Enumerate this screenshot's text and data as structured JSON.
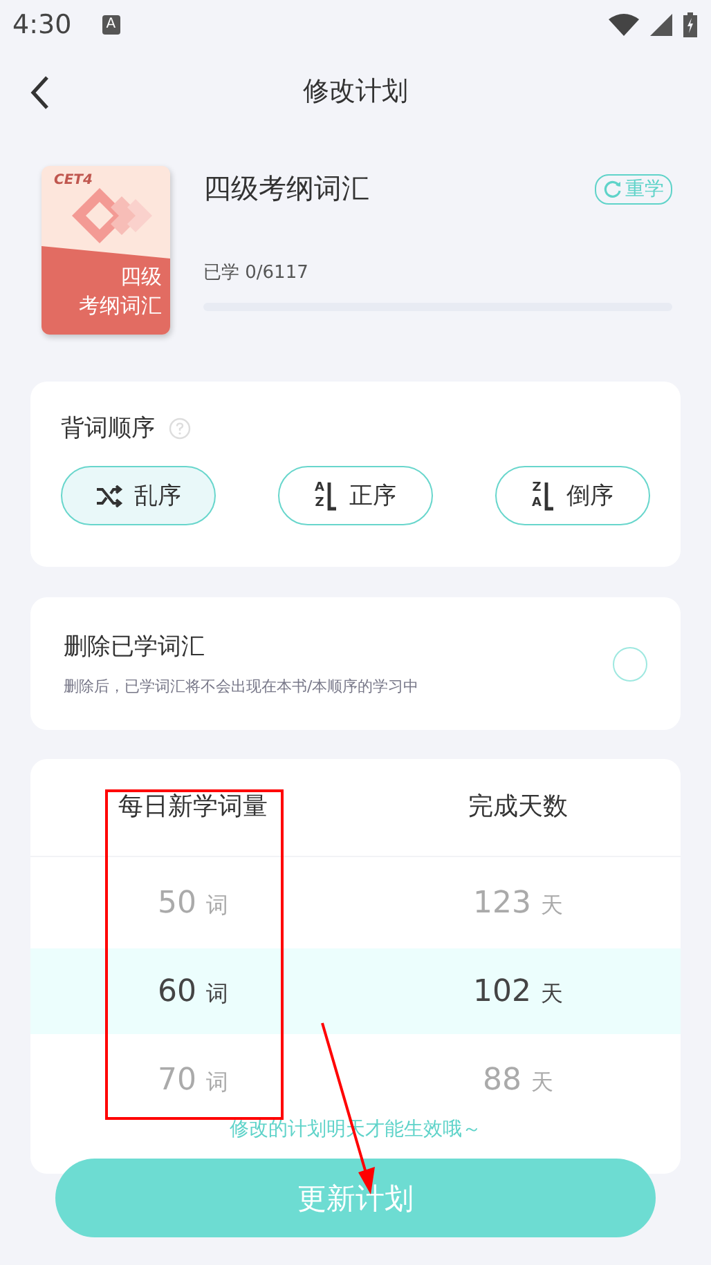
{
  "status_bar": {
    "time": "4:30",
    "notification_icon": "A"
  },
  "header": {
    "title": "修改计划"
  },
  "book": {
    "cover_tag": "CET4",
    "cover_title_line1": "四级",
    "cover_title_line2": "考纲词汇",
    "title": "四级考纲词汇",
    "restart": "重学",
    "progress_text": "已学 0/6117",
    "level": 0
  },
  "order": {
    "title": "背词顺序",
    "options": [
      {
        "kind": "shuffle",
        "label": "乱序",
        "selected": true
      },
      {
        "kind": "az",
        "label": "正序",
        "letters": [
          "A",
          "Z"
        ],
        "selected": false
      },
      {
        "kind": "za",
        "label": "倒序",
        "letters": [
          "Z",
          "A"
        ],
        "selected": false
      }
    ]
  },
  "delete_learned": {
    "title": "删除已学词汇",
    "description": "删除后，已学词汇将不会出现在本书/本顺序的学习中",
    "on": false
  },
  "picker": {
    "columns": [
      "每日新学词量",
      "完成天数"
    ],
    "rows": [
      {
        "words": "50",
        "words_unit": "词",
        "days": "123",
        "days_unit": "天",
        "selected": false
      },
      {
        "words": "60",
        "words_unit": "词",
        "days": "102",
        "days_unit": "天",
        "selected": true
      },
      {
        "words": "70",
        "words_unit": "词",
        "days": "88",
        "days_unit": "天",
        "selected": false
      }
    ]
  },
  "hint": "修改的计划明天才能生效哦～",
  "update_button": "更新计划"
}
